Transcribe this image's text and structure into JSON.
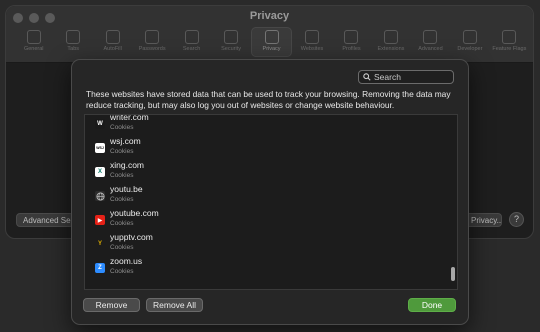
{
  "window": {
    "title": "Privacy",
    "toolbar": [
      {
        "label": "General",
        "icon": "switch-icon"
      },
      {
        "label": "Tabs",
        "icon": "tabs-icon"
      },
      {
        "label": "AutoFill",
        "icon": "pencil-icon"
      },
      {
        "label": "Passwords",
        "icon": "key-icon"
      },
      {
        "label": "Search",
        "icon": "search-icon"
      },
      {
        "label": "Security",
        "icon": "lock-icon"
      },
      {
        "label": "Privacy",
        "icon": "hand-icon"
      },
      {
        "label": "Websites",
        "icon": "globe-icon"
      },
      {
        "label": "Profiles",
        "icon": "person-icon"
      },
      {
        "label": "Extensions",
        "icon": "puzzle-icon"
      },
      {
        "label": "Advanced",
        "icon": "gear-icon"
      },
      {
        "label": "Developer",
        "icon": "hammer-icon"
      },
      {
        "label": "Feature Flags",
        "icon": "flag-icon"
      }
    ],
    "active_toolbar_item": "Privacy",
    "advanced_button_label": "Advanced Se",
    "privacy_button_label": "Privacy...",
    "help_label": "?"
  },
  "sheet": {
    "search_placeholder": "Search",
    "description": "These websites have stored data that can be used to track your browsing. Removing the data may reduce tracking, but may also log you out of websites or change website behaviour.",
    "sites": [
      {
        "name": "writer.com",
        "kind": "Cookies",
        "favicon": "W",
        "icon_color": "#1a1a1a",
        "icon_text_color": "#ffffff"
      },
      {
        "name": "wsj.com",
        "kind": "Cookies",
        "favicon": "WSJ",
        "icon_color": "#ffffff",
        "icon_text_color": "#000000"
      },
      {
        "name": "xing.com",
        "kind": "Cookies",
        "favicon": "X",
        "icon_color": "#ffffff",
        "icon_text_color": "#0a7a6b"
      },
      {
        "name": "youtu.be",
        "kind": "Cookies",
        "favicon": "globe",
        "icon_color": "#2c2c2c",
        "icon_text_color": "#bbbbbb"
      },
      {
        "name": "youtube.com",
        "kind": "Cookies",
        "favicon": "▶",
        "icon_color": "#e62117",
        "icon_text_color": "#ffffff"
      },
      {
        "name": "yupptv.com",
        "kind": "Cookies",
        "favicon": "Y",
        "icon_color": "#1c1c1c",
        "icon_text_color": "#e0b000"
      },
      {
        "name": "zoom.us",
        "kind": "Cookies",
        "favicon": "Z",
        "icon_color": "#2d8cff",
        "icon_text_color": "#ffffff"
      }
    ],
    "buttons": {
      "remove": "Remove",
      "remove_all": "Remove All",
      "done": "Done"
    }
  },
  "colors": {
    "done_button": "#4f9a3c",
    "background": "#1e1e1e"
  }
}
